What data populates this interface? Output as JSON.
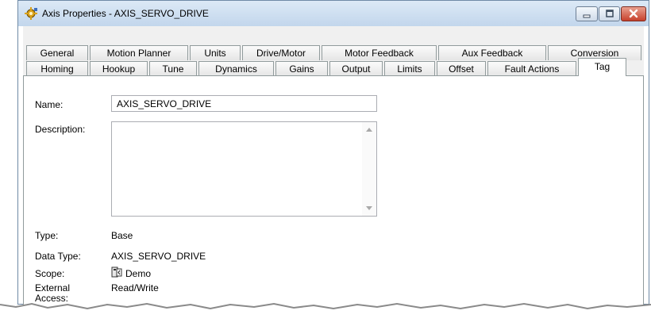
{
  "window": {
    "title": "Axis Properties - AXIS_SERVO_DRIVE",
    "icon": "gear-icon",
    "controls": [
      "minimize",
      "maximize",
      "close"
    ]
  },
  "tabs": {
    "row1": [
      "General",
      "Motion Planner",
      "Units",
      "Drive/Motor",
      "Motor Feedback",
      "Aux Feedback",
      "Conversion"
    ],
    "row2": [
      "Homing",
      "Hookup",
      "Tune",
      "Dynamics",
      "Gains",
      "Output",
      "Limits",
      "Offset",
      "Fault Actions",
      "Tag"
    ],
    "active": "Tag"
  },
  "form": {
    "name_label": "Name:",
    "name_value": "AXIS_SERVO_DRIVE",
    "description_label": "Description:",
    "description_value": "",
    "type_label": "Type:",
    "type_value": "Base",
    "data_type_label": "Data Type:",
    "data_type_value": "AXIS_SERVO_DRIVE",
    "scope_label": "Scope:",
    "scope_value": "Demo",
    "scope_icon": "controller-icon",
    "external_access_label_1": "External",
    "external_access_label_2": "Access:",
    "external_access_value": "Read/Write"
  },
  "colors": {
    "titlebar": "#c9dbef",
    "close_button": "#c7402c",
    "panel_background": "#ffffff",
    "dialog_background": "#f0f0f0"
  }
}
